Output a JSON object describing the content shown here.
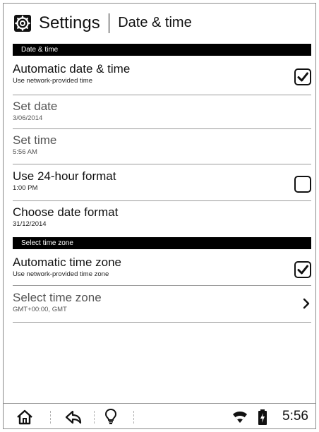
{
  "header": {
    "title": "Settings",
    "subtitle": "Date & time"
  },
  "sections": {
    "date_time": {
      "title": "Date & time"
    },
    "time_zone": {
      "title": "Select time zone"
    }
  },
  "rows": {
    "auto_date_time": {
      "label": "Automatic date & time",
      "sub": "Use network-provided time",
      "checked": true
    },
    "set_date": {
      "label": "Set date",
      "sub": "3/06/2014",
      "enabled": false
    },
    "set_time": {
      "label": "Set time",
      "sub": "5:56 AM",
      "enabled": false
    },
    "use_24h": {
      "label": "Use 24-hour format",
      "sub": "1:00 PM",
      "checked": false
    },
    "date_format": {
      "label": "Choose date format",
      "sub": "31/12/2014"
    },
    "auto_time_zone": {
      "label": "Automatic time zone",
      "sub": "Use network-provided time zone",
      "checked": true
    },
    "select_time_zone": {
      "label": "Select time zone",
      "sub": "GMT+00:00, GMT",
      "enabled": false
    }
  },
  "status_bar": {
    "clock": "5:56",
    "icons": [
      "home-icon",
      "back-icon",
      "light-bulb-icon",
      "wifi-icon",
      "battery-charging-icon"
    ]
  },
  "colors": {
    "section_header_bg": "#000000",
    "section_header_text": "#ffffff",
    "divider": "#9a9a9a",
    "disabled_text": "#555555"
  }
}
